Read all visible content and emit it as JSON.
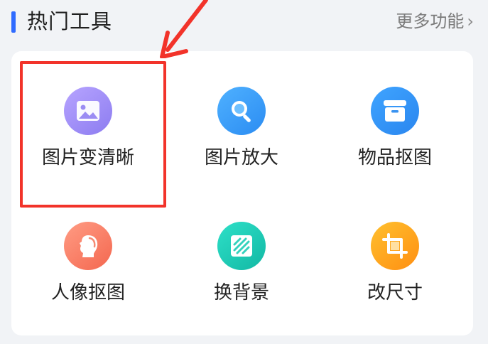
{
  "header": {
    "title": "热门工具",
    "more_label": "更多功能",
    "more_chevron": "›"
  },
  "tools": [
    {
      "label": "图片变清晰",
      "icon": "image-icon",
      "color": "#9a89f5"
    },
    {
      "label": "图片放大",
      "icon": "magnifier-icon",
      "color": "#3a9ff9"
    },
    {
      "label": "物品抠图",
      "icon": "box-icon",
      "color": "#3596f6"
    },
    {
      "label": "人像抠图",
      "icon": "portrait-icon",
      "color": "#f77d63"
    },
    {
      "label": "换背景",
      "icon": "background-icon",
      "color": "#1ecbb4"
    },
    {
      "label": "改尺寸",
      "icon": "crop-icon",
      "color": "#ffa41e"
    }
  ],
  "annotation": {
    "highlight_color": "#f2332a",
    "highlighted_tool": "图片变清晰"
  }
}
